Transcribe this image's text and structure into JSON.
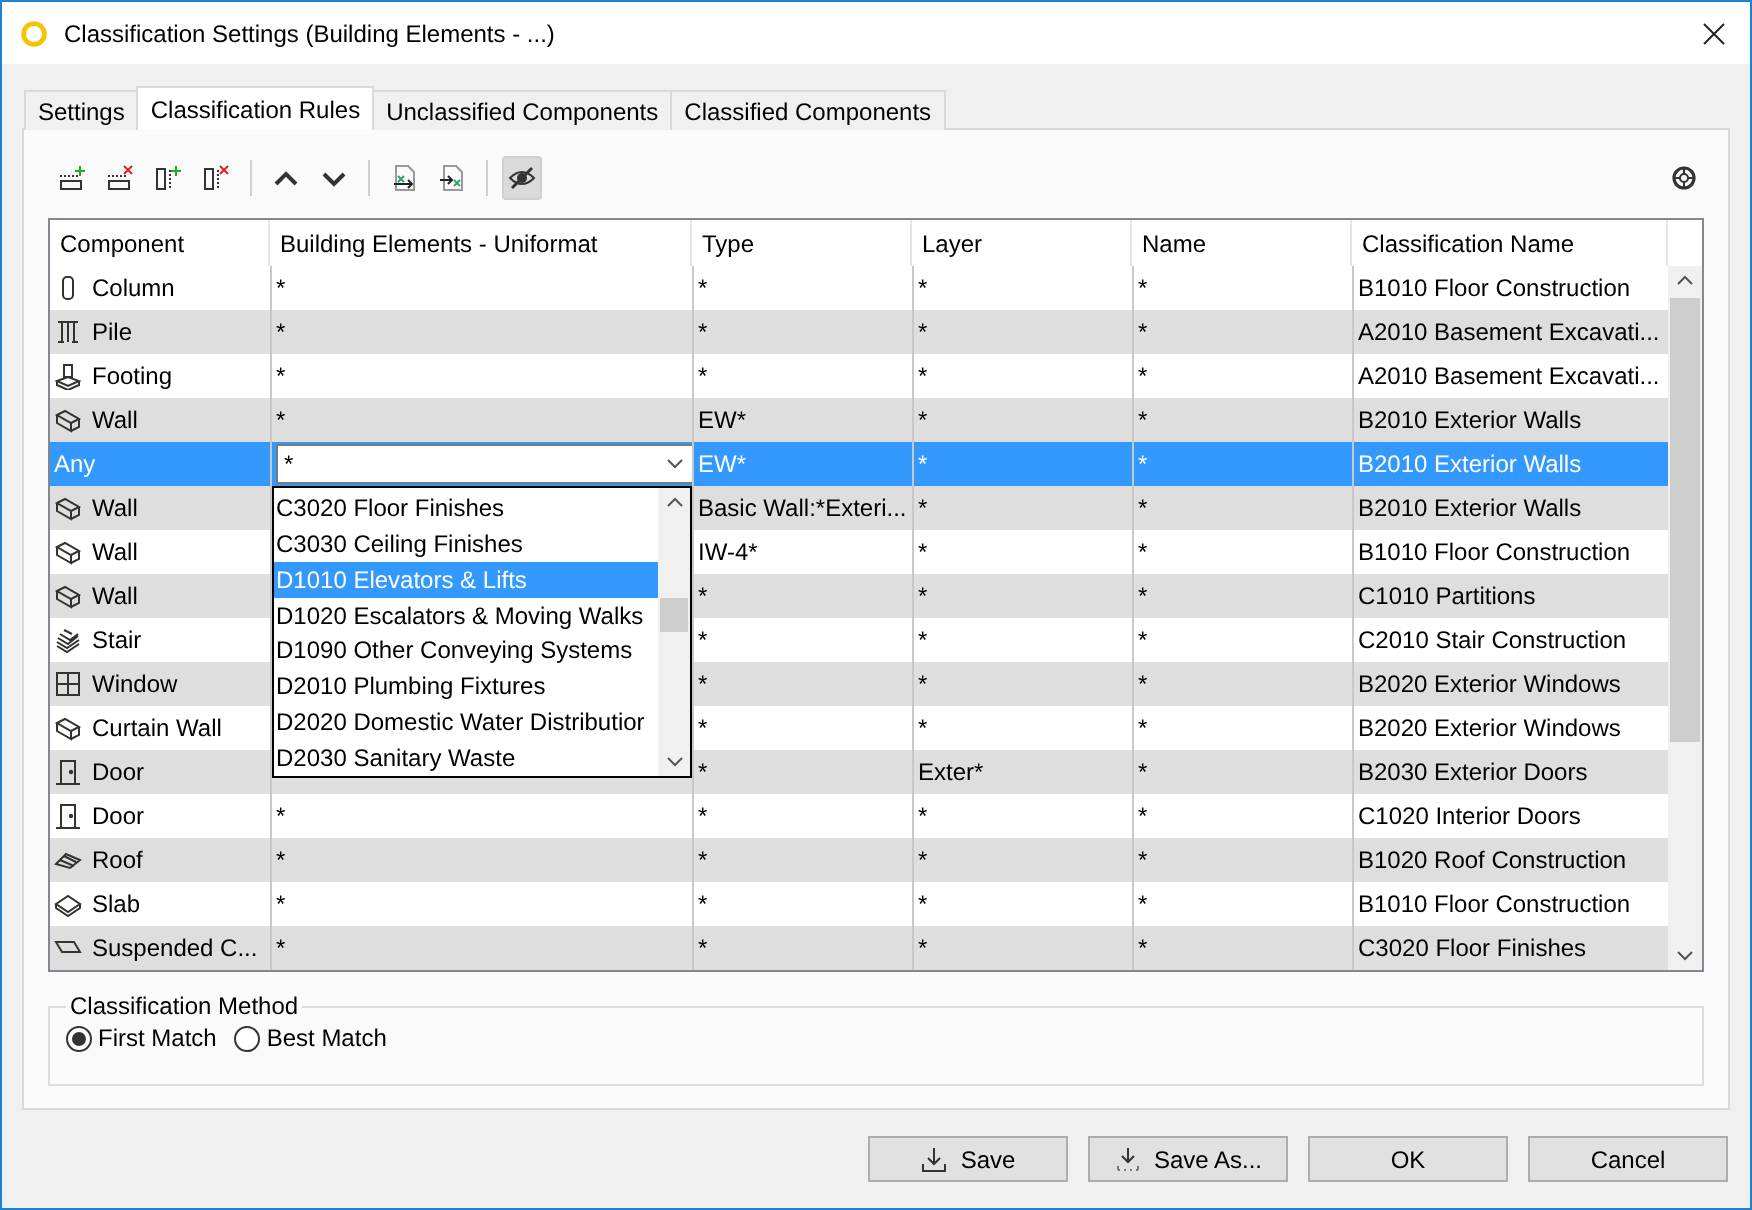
{
  "window": {
    "title": "Classification Settings (Building Elements - ...)"
  },
  "tabs": [
    {
      "label": "Settings",
      "selected": false
    },
    {
      "label": "Classification Rules",
      "selected": true
    },
    {
      "label": "Unclassified Components",
      "selected": false
    },
    {
      "label": "Classified Components",
      "selected": false
    }
  ],
  "toolbar": [
    {
      "kind": "add-row"
    },
    {
      "kind": "delete-row"
    },
    {
      "kind": "add-column"
    },
    {
      "kind": "delete-column"
    },
    {
      "kind": "separator"
    },
    {
      "kind": "move-up"
    },
    {
      "kind": "move-down"
    },
    {
      "kind": "separator"
    },
    {
      "kind": "import"
    },
    {
      "kind": "export"
    },
    {
      "kind": "separator"
    },
    {
      "kind": "visibility",
      "on": true
    }
  ],
  "table": {
    "columns": [
      "Component",
      "Building Elements - Uniformat",
      "Type",
      "Layer",
      "Name",
      "Classification Name"
    ],
    "rows": [
      {
        "kind": "column",
        "component": "Column",
        "building_element": "*",
        "type": "*",
        "layer": "*",
        "name": "*",
        "classification": "B1010 Floor Construction",
        "selected": false
      },
      {
        "kind": "pile",
        "component": "Pile",
        "building_element": "*",
        "type": "*",
        "layer": "*",
        "name": "*",
        "classification": "A2010 Basement Excavati...",
        "selected": false
      },
      {
        "kind": "footing",
        "component": "Footing",
        "building_element": "*",
        "type": "*",
        "layer": "*",
        "name": "*",
        "classification": "A2010 Basement Excavati...",
        "selected": false
      },
      {
        "kind": "wall",
        "component": "Wall",
        "building_element": "*",
        "type": "EW*",
        "layer": "*",
        "name": "*",
        "classification": "B2010 Exterior Walls",
        "selected": false
      },
      {
        "kind": "any",
        "component": "Any",
        "building_element": "*",
        "type": "EW*",
        "layer": "*",
        "name": "*",
        "classification": "B2010 Exterior Walls",
        "selected": true,
        "editing": true
      },
      {
        "kind": "wall",
        "component": "Wall",
        "type": "Basic Wall:*Exteri...",
        "layer": "*",
        "name": "*",
        "classification": "B2010 Exterior Walls",
        "selected": false
      },
      {
        "kind": "wall",
        "component": "Wall",
        "type": "IW-4*",
        "layer": "*",
        "name": "*",
        "classification": "B1010 Floor Construction",
        "selected": false
      },
      {
        "kind": "wall",
        "component": "Wall",
        "type": "*",
        "layer": "*",
        "name": "*",
        "classification": "C1010 Partitions",
        "selected": false
      },
      {
        "kind": "stair",
        "component": "Stair",
        "type": "*",
        "layer": "*",
        "name": "*",
        "classification": "C2010 Stair Construction",
        "selected": false
      },
      {
        "kind": "window",
        "component": "Window",
        "type": "*",
        "layer": "*",
        "name": "*",
        "classification": "B2020 Exterior Windows",
        "selected": false
      },
      {
        "kind": "wall",
        "component": "Curtain Wall",
        "type": "*",
        "layer": "*",
        "name": "*",
        "classification": "B2020 Exterior Windows",
        "selected": false
      },
      {
        "kind": "door",
        "component": "Door",
        "type": "*",
        "layer": "Exter*",
        "name": "*",
        "classification": "B2030 Exterior Doors",
        "selected": false
      },
      {
        "kind": "door",
        "component": "Door",
        "building_element": "*",
        "type": "*",
        "layer": "*",
        "name": "*",
        "classification": "C1020 Interior Doors",
        "selected": false
      },
      {
        "kind": "roof",
        "component": "Roof",
        "building_element": "*",
        "type": "*",
        "layer": "*",
        "name": "*",
        "classification": "B1020 Roof Construction",
        "selected": false
      },
      {
        "kind": "slab",
        "component": "Slab",
        "building_element": "*",
        "type": "*",
        "layer": "*",
        "name": "*",
        "classification": "B1010 Floor Construction",
        "selected": false
      },
      {
        "kind": "ceiling",
        "component": "Suspended C...",
        "building_element": "*",
        "type": "*",
        "layer": "*",
        "name": "*",
        "classification": "C3020 Floor Finishes",
        "selected": false
      }
    ],
    "dropdown": {
      "options": [
        {
          "label": "C3020 Floor Finishes",
          "selected": false
        },
        {
          "label": "C3030 Ceiling Finishes",
          "selected": false
        },
        {
          "label": "D1010 Elevators & Lifts",
          "selected": true
        },
        {
          "label": "D1020 Escalators & Moving Walks",
          "selected": false
        },
        {
          "label": "D1090 Other Conveying Systems",
          "selected": false
        },
        {
          "label": "D2010 Plumbing Fixtures",
          "selected": false
        },
        {
          "label": "D2020 Domestic Water Distributior",
          "selected": false
        },
        {
          "label": "D2030 Sanitary Waste",
          "selected": false
        }
      ]
    }
  },
  "classification_method": {
    "title": "Classification Method",
    "options": [
      {
        "label": "First Match",
        "selected": true
      },
      {
        "label": "Best Match",
        "selected": false
      }
    ]
  },
  "buttons": [
    {
      "kind": "save",
      "label": "Save"
    },
    {
      "kind": "save-as",
      "label": "Save As..."
    },
    {
      "kind": "plain",
      "label": "OK"
    },
    {
      "kind": "plain",
      "label": "Cancel"
    }
  ]
}
